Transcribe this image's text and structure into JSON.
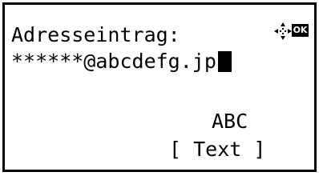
{
  "screen": {
    "title": "Adresseintrag:",
    "entry_value": "******@abcdefg.jp",
    "input_mode": "ABC",
    "softkey_label": "[ Text ]",
    "icons": {
      "navigation": "four-way-arrow-icon",
      "ok": "OK"
    }
  }
}
